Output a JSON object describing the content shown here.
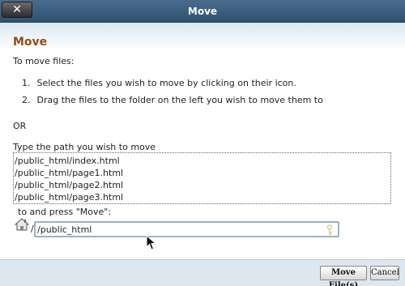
{
  "window": {
    "title": "Move",
    "close_label": "✕"
  },
  "content": {
    "heading": "Move",
    "intro": "To move files:",
    "steps": [
      {
        "num": "1.",
        "text": "Select the files you wish to move by clicking on their icon."
      },
      {
        "num": "2.",
        "text": "Drag the files to the folder on the left you wish to move them to"
      }
    ],
    "or_text": "OR",
    "path_label": "Type the path you wish to move",
    "files": [
      "/public_html/index.html",
      "/public_html/page1.html",
      "/public_html/page2.html",
      "/public_html/page3.html"
    ],
    "press_label": "to and press \"Move\":",
    "path_prefix": "/",
    "destination": {
      "value": "/public_html"
    }
  },
  "footer": {
    "move_button": "Move File(s)",
    "cancel_button": "Cancel"
  },
  "icons": {
    "home": "home-icon",
    "key": "key-icon",
    "close": "close-icon",
    "cursor": "mouse-cursor-icon"
  }
}
